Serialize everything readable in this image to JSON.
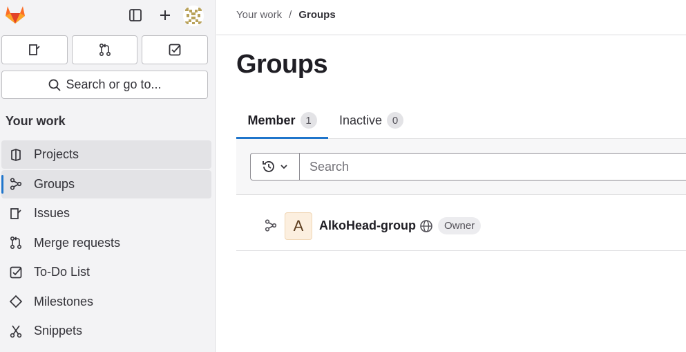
{
  "sidebar": {
    "search_label": "Search or go to...",
    "section_title": "Your work",
    "items": [
      {
        "label": "Projects",
        "icon": "project-icon"
      },
      {
        "label": "Groups",
        "icon": "group-icon"
      },
      {
        "label": "Issues",
        "icon": "issues-icon"
      },
      {
        "label": "Merge requests",
        "icon": "merge-request-icon"
      },
      {
        "label": "To-Do List",
        "icon": "todo-icon"
      },
      {
        "label": "Milestones",
        "icon": "milestone-icon"
      },
      {
        "label": "Snippets",
        "icon": "snippet-icon"
      }
    ]
  },
  "breadcrumb": {
    "parent": "Your work",
    "separator": "/",
    "current": "Groups"
  },
  "page": {
    "title": "Groups"
  },
  "tabs": [
    {
      "label": "Member",
      "count": "1"
    },
    {
      "label": "Inactive",
      "count": "0"
    }
  ],
  "filter": {
    "search_placeholder": "Search"
  },
  "groups": [
    {
      "avatar_letter": "A",
      "name": "AlkoHead-group",
      "role": "Owner"
    }
  ],
  "colors": {
    "accent": "#1f75cb",
    "logo_orange": "#e24329"
  }
}
